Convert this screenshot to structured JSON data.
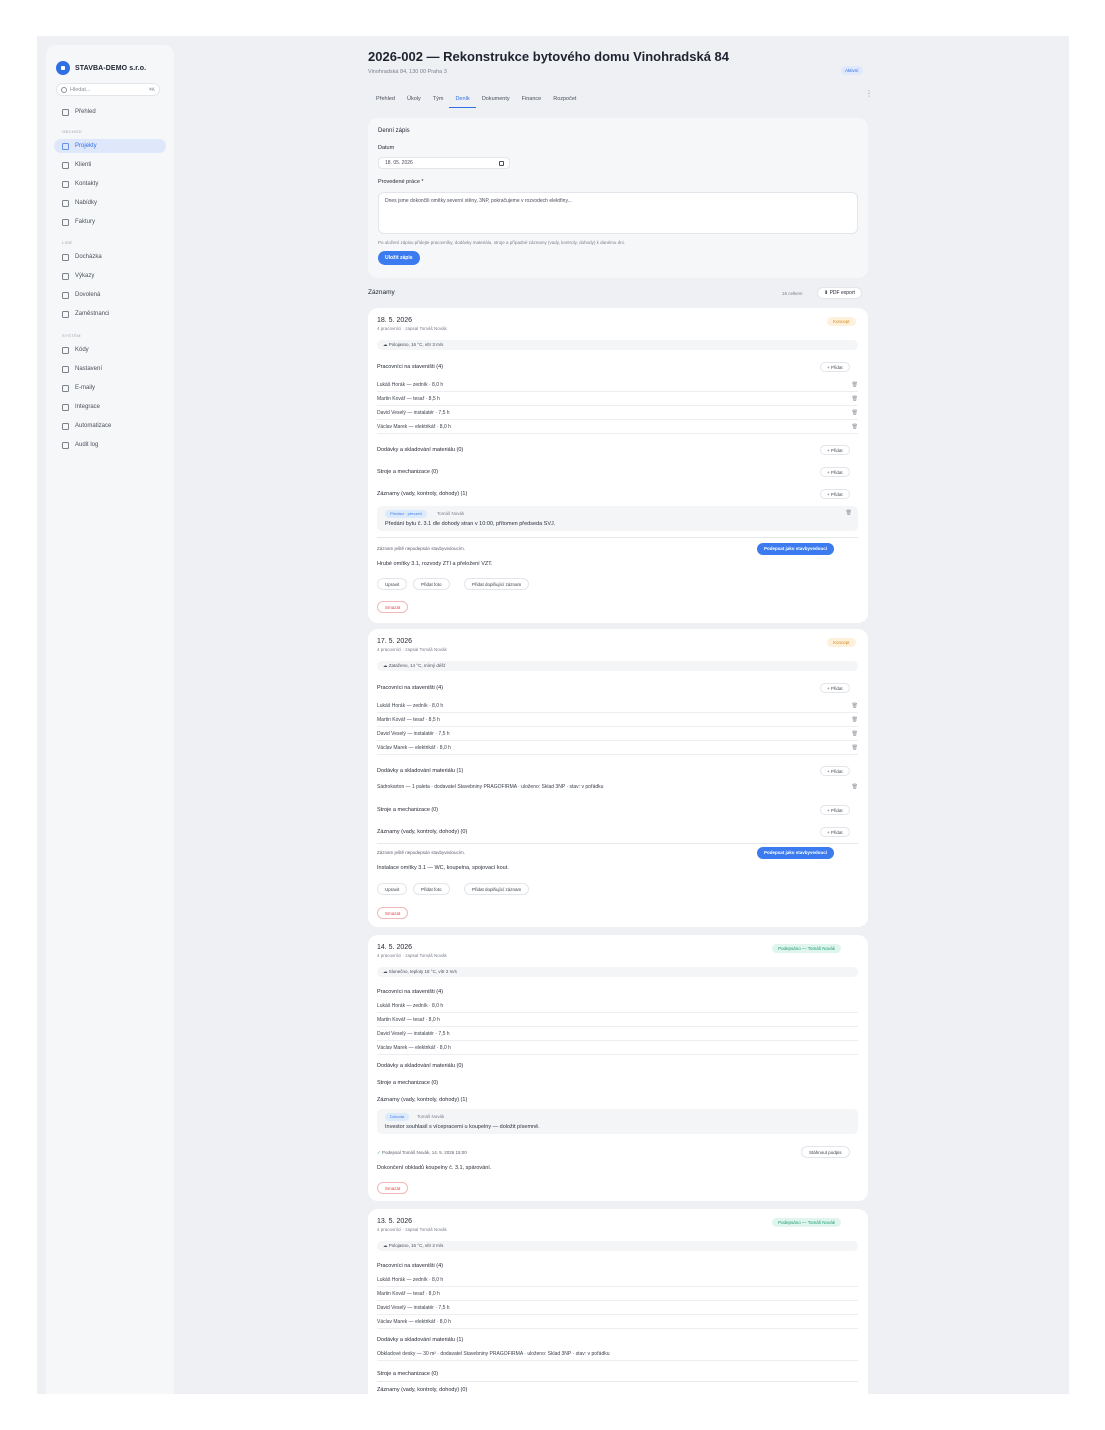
{
  "app": {
    "company": "STAVBA-DEMO s.r.o."
  },
  "search": {
    "placeholder": "Hledat...",
    "shortcut": "⌘K"
  },
  "sidebar": {
    "items": [
      {
        "label": "Přehled",
        "icon": "grid-icon"
      },
      {
        "label": "Projekty",
        "icon": "building-icon"
      },
      {
        "label": "Klienti",
        "icon": "users-icon"
      },
      {
        "label": "Kontakty",
        "icon": "contacts-icon"
      },
      {
        "label": "Nabídky",
        "icon": "document-icon"
      },
      {
        "label": "Faktury",
        "icon": "invoice-icon"
      },
      {
        "label": "Docházka",
        "icon": "clock-icon"
      },
      {
        "label": "Výkazy",
        "icon": "chart-icon"
      },
      {
        "label": "Dovolená",
        "icon": "calendar-icon"
      },
      {
        "label": "Zaměstnanci",
        "icon": "people-icon"
      },
      {
        "label": "Kódy",
        "icon": "grid-icon"
      },
      {
        "label": "Nastavení",
        "icon": "gear-icon"
      },
      {
        "label": "E-maily",
        "icon": "mail-icon"
      },
      {
        "label": "Integrace",
        "icon": "link-icon"
      },
      {
        "label": "Automatizace",
        "icon": "automation-icon"
      },
      {
        "label": "Audit log",
        "icon": "history-icon"
      }
    ],
    "sections": [
      "OBCHOD",
      "LIDÉ",
      "SYSTÉM"
    ]
  },
  "project": {
    "title": "2026-002 — Rekonstrukce bytového domu Vinohradská 84",
    "address": "Vinohradská 84, 130 00 Praha 3",
    "status": "Aktivní"
  },
  "tabs": [
    "Přehled",
    "Úkoly",
    "Tým",
    "Deník",
    "Dokumenty",
    "Finance",
    "Rozpočet"
  ],
  "form": {
    "title": "Denní zápis",
    "date_label": "Datum",
    "date_value": "18. 05. 2026",
    "work_label": "Provedené práce *",
    "work_value": "Dnes jsme dokončili omítky severní stěny, 3NP, pokračujeme v rozvodech elektřiny...",
    "hint": "Po uložení zápisu přidejte pracovníky, dodávky materiálu, stroje a případné záznamy (vady, kontroly, dohody) k danému dni.",
    "save": "Uložit zápis"
  },
  "records": {
    "title": "Záznamy",
    "count": "16 celkem",
    "export": "PDF export"
  },
  "entries": [
    {
      "date": "18. 5. 2026",
      "meta": "4 pracovníci · zapsal Tomáš Novák",
      "status": "Koncept",
      "weather": "☁ Polojasno, 16 °C, vítr 3 m/s",
      "workers_h": "Pracovníci na staveništi (4)",
      "workers": [
        "Lukáš Horák — zedník · 8,0 h",
        "Martin Kovář — tesař · 8,5 h",
        "David Veselý — instalatér · 7,5 h",
        "Václav Marek — elektrikář · 8,0 h"
      ],
      "materials_h": "Dodávky a skladování materiálu (0)",
      "machines_h": "Stroje a mechanizace (0)",
      "records_h": "Záznamy (vady, kontroly, dohody) (1)",
      "note": {
        "tag": "Předání · převzetí",
        "who": "Tomáš Novák",
        "text": "Předání bytu č. 3.1 dle dohody stran v 10:00, přítomen předseda SVJ."
      },
      "sign_text": "Záznam ještě nepodepsán stavbyvedoucím.",
      "work_text": "Hrubé omítky 3.1, rozvody ZTI a přeložení VZT.",
      "chips": [
        "Upravit",
        "Přidat foto",
        "Přidat doplňující záznam"
      ],
      "sign_btn": "Podepsat jako stavbyvedoucí",
      "delete": "Smazat"
    },
    {
      "date": "17. 5. 2026",
      "meta": "4 pracovníci · zapsal Tomáš Novák",
      "status": "Koncept",
      "weather": "☁ Zataženo, 14 °C, mírný déšť",
      "workers_h": "Pracovníci na staveništi (4)",
      "workers": [
        "Lukáš Horák — zedník · 8,0 h",
        "Martin Kovář — tesař · 8,5 h",
        "David Veselý — instalatér · 7,5 h",
        "Václav Marek — elektrikář · 8,0 h"
      ],
      "materials_h": "Dodávky a skladování materiálu (1)",
      "material": "Sádrokarton — 1 paleta · dodavatel Stavebniny PRAGOFIRMA · uloženo: Sklad 3NP · stav: v pořádku",
      "machines_h": "Stroje a mechanizace (0)",
      "records_h": "Záznamy (vady, kontroly, dohody) (0)",
      "sign_text": "Záznam ještě nepodepsán stavbyvedoucím.",
      "work_text": "Instalace omítky 3.1 — WC, koupelna, spojovací kout.",
      "chips": [
        "Upravit",
        "Přidat foto",
        "Přidat doplňující záznam"
      ],
      "sign_btn": "Podepsat jako stavbyvedoucí",
      "delete": "Smazat"
    },
    {
      "date": "14. 5. 2026",
      "meta": "4 pracovníci · zapsal Tomáš Novák",
      "status": "Podepsáno — Tomáš Novák",
      "weather": "☁ Slunečno, teploty 18 °C, vítr 2 m/s",
      "workers_h": "Pracovníci na staveništi (4)",
      "workers": [
        "Lukáš Horák — zedník · 8,0 h",
        "Martin Kovář — tesař · 8,0 h",
        "David Veselý — instalatér · 7,5 h",
        "Václav Marek — elektrikář · 8,0 h"
      ],
      "materials_h": "Dodávky a skladování materiálu (0)",
      "machines_h": "Stroje a mechanizace (0)",
      "records_h": "Záznamy (vady, kontroly, dohody) (1)",
      "note": {
        "tag": "Dohoda",
        "who": "Tomáš Novák",
        "text": "Investor souhlasil s vícepracemi u koupelny — doložit písemně."
      },
      "sign_text": "Podepsal Tomáš Novák, 14. 5. 2026 15:00",
      "work_text": "Dokončení obkladů koupelny č. 3.1, spárování.",
      "download": "Stáhnout podpis",
      "delete": "Smazat"
    },
    {
      "date": "13. 5. 2026",
      "meta": "4 pracovníci · zapsal Tomáš Novák",
      "status": "Podepsáno — Tomáš Novák",
      "weather": "☁ Polojasno, 16 °C, vítr 2 m/s",
      "workers_h": "Pracovníci na staveništi (4)",
      "workers": [
        "Lukáš Horák — zedník · 8,0 h",
        "Martin Kovář — tesař · 8,0 h",
        "David Veselý — instalatér · 7,5 h",
        "Václav Marek — elektrikář · 8,0 h"
      ],
      "materials_h": "Dodávky a skladování materiálu (1)",
      "material": "Obkladové desky — 30 m² · dodavatel Stavebniny PRAGOFIRMA · uloženo: Sklad 3NP · stav: v pořádku",
      "machines_h": "Stroje a mechanizace (0)",
      "records_h": "Záznamy (vady, kontroly, dohody) (0)"
    }
  ]
}
